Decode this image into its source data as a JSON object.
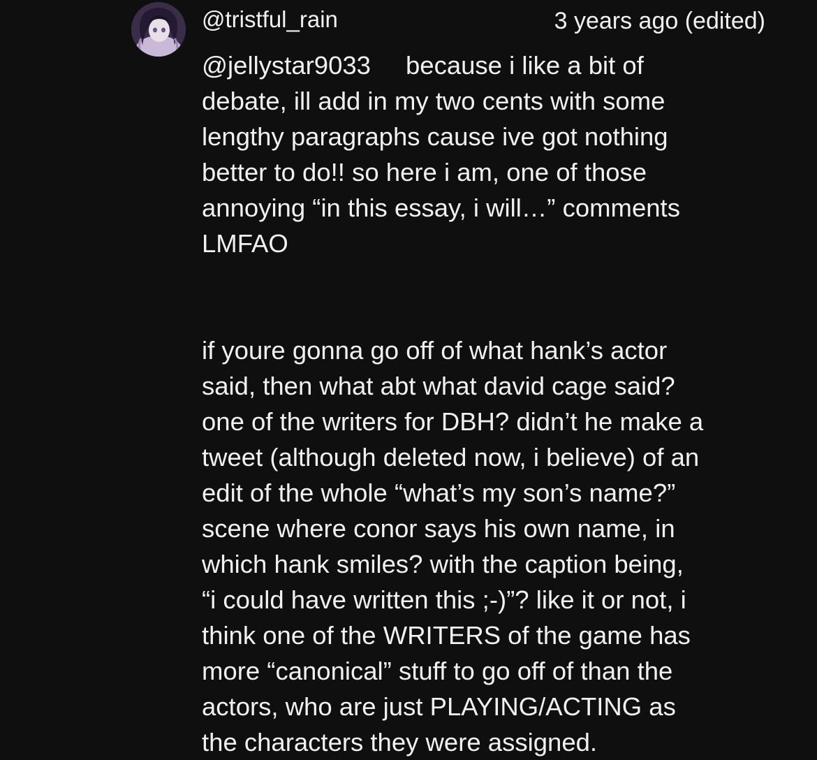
{
  "comment": {
    "author_handle": "@tristful_rain",
    "timestamp": "3 years ago (edited)",
    "reply_mention": "@jellystar9033",
    "paragraph1_lines": [
      "because i like a bit of",
      "debate, ill add in my two cents with some",
      "lengthy paragraphs cause ive got nothing",
      "better to do!! so here i am, one of those",
      "annoying “in this essay, i will…” comments",
      "LMFAO"
    ],
    "paragraph2_lines": [
      "if youre gonna go off of what hank’s actor",
      "said, then what abt what david cage said?",
      "one of the writers for DBH? didn’t he make a",
      "tweet (although deleted now, i believe) of an",
      "edit of the whole “what’s my son’s name?”",
      "scene where conor says his own name, in",
      "which hank smiles? with the caption being,",
      "“i could have written this ;-)”? like it or not, i",
      "think one of the WRITERS of the game has",
      "more “canonical” stuff to go off of than the",
      "actors, who are just PLAYING/ACTING as",
      "the characters they were assigned."
    ]
  },
  "colors": {
    "background": "#0f0f0f",
    "text": "#f1f1f1"
  },
  "icons": {
    "avatar": "anime-character-avatar"
  }
}
